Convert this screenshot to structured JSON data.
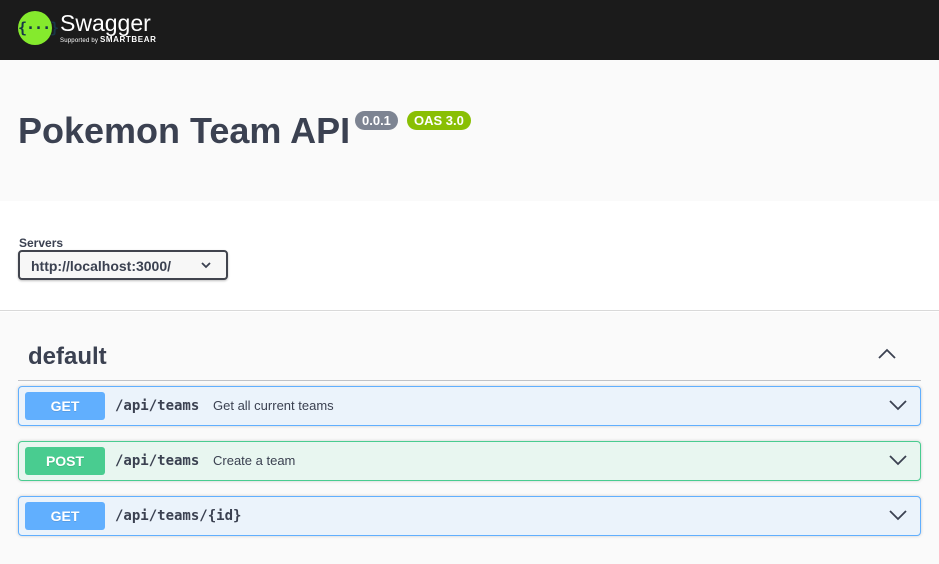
{
  "topbar": {
    "logo_glyph": "{···}",
    "brand": "Swagger",
    "supported_by": "Supported by",
    "smartbear": "SMARTBEAR",
    "colors": {
      "background": "#1b1b1b",
      "logo": "#85ea2d"
    }
  },
  "info": {
    "title": "Pokemon Team API",
    "version_badge": "0.0.1",
    "oas_badge": "OAS 3.0"
  },
  "servers": {
    "label": "Servers",
    "selected": "http://localhost:3000/",
    "icon": "chevron-down-icon"
  },
  "tag": {
    "name": "default",
    "toggle_icon": "chevron-up-icon"
  },
  "operations": [
    {
      "method": "GET",
      "path": "/api/teams",
      "summary": "Get all current teams",
      "color": "#61affe"
    },
    {
      "method": "POST",
      "path": "/api/teams",
      "summary": "Create a team",
      "color": "#49cc90"
    },
    {
      "method": "GET",
      "path": "/api/teams/{id}",
      "summary": "",
      "color": "#61affe"
    }
  ]
}
